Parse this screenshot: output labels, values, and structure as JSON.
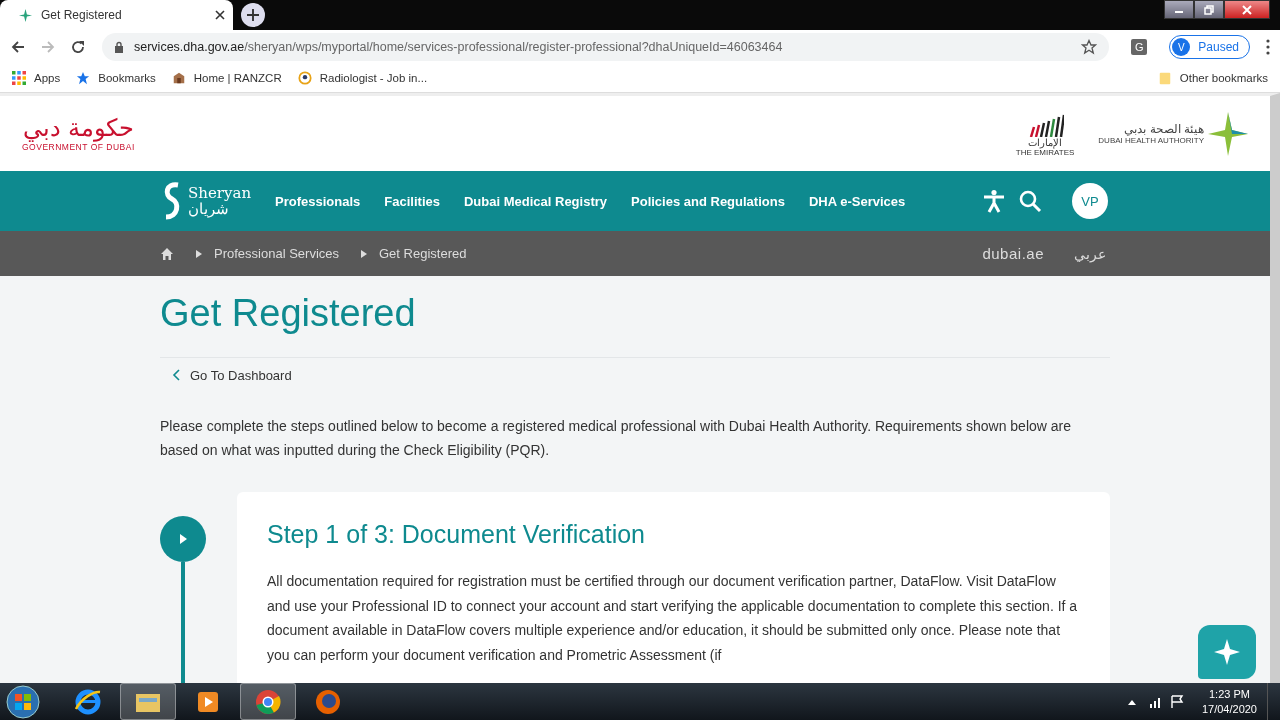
{
  "browser": {
    "tab_title": "Get Registered",
    "url_host": "services.dha.gov.ae",
    "url_path": "/sheryan/wps/myportal/home/services-professional/register-professional?dhaUniqueId=46063464",
    "extension": "G",
    "profile": {
      "initial": "V",
      "label": "Paused"
    },
    "bookmarks": [
      {
        "kind": "apps",
        "label": "Apps"
      },
      {
        "kind": "star",
        "label": "Bookmarks"
      },
      {
        "kind": "crest",
        "label": "Home | RANZCR"
      },
      {
        "kind": "badge",
        "label": "Radiologist - Job in..."
      }
    ],
    "other_bookmarks": "Other bookmarks"
  },
  "header": {
    "gov": {
      "arabic": "حكومة دبي",
      "english": "GOVERNMENT OF DUBAI"
    },
    "emirates": {
      "arabic": "الإمارات",
      "english": "THE EMIRATES"
    },
    "dha": {
      "arabic": "هيئة الصحة بدبي",
      "english": "DUBAI HEALTH AUTHORITY"
    }
  },
  "nav": {
    "brand": {
      "latin": "Sheryan",
      "arabic": "شريان"
    },
    "items": [
      "Professionals",
      "Facilities",
      "Dubai Medical Registry",
      "Policies and Regulations",
      "DHA e-Services"
    ],
    "avatar": "VP"
  },
  "breadcrumb": {
    "items": [
      "Professional Services",
      "Get Registered"
    ],
    "portal": "dubai.ae",
    "language": "عربي"
  },
  "page": {
    "title": "Get Registered",
    "back_link": "Go To Dashboard",
    "intro": "Please complete the steps outlined below to become a registered medical professional with Dubai Health Authority. Requirements shown below are based on what was inputted during the Check Eligibility (PQR).",
    "steps": [
      {
        "title": "Step 1 of 3: Document Verification",
        "body": "All documentation required for registration must be certified through our document verification partner, DataFlow. Visit DataFlow and use your Professional ID to connect your account and start verifying the applicable documentation to complete this section. If a document available in DataFlow covers multiple experience and/or education, it should be submitted only once. Please note that you can perform your document verification and Prometric Assessment (if"
      }
    ]
  },
  "taskbar": {
    "apps": [
      {
        "kind": "ie",
        "running": false
      },
      {
        "kind": "explorer",
        "running": true
      },
      {
        "kind": "media",
        "running": false
      },
      {
        "kind": "chrome",
        "running": true
      },
      {
        "kind": "firefox",
        "running": false
      }
    ],
    "time": "1:23 PM",
    "date": "17/04/2020"
  }
}
